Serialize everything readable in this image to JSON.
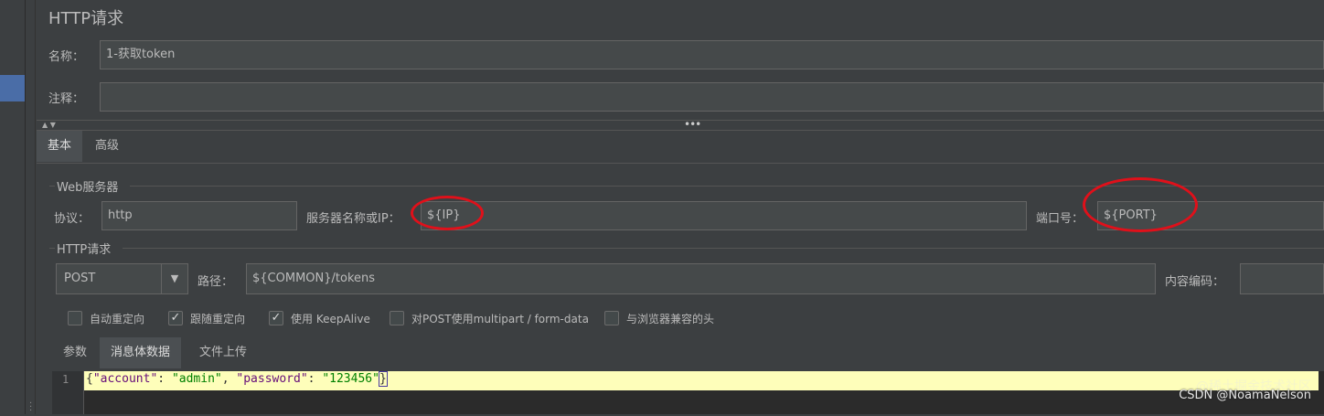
{
  "panel": {
    "title": "HTTP请求"
  },
  "name_row": {
    "label": "名称：",
    "value": "1-获取token"
  },
  "comment_row": {
    "label": "注释：",
    "value": ""
  },
  "tabs": {
    "basic": "基本",
    "advanced": "高级"
  },
  "web_server": {
    "section_title": "Web服务器",
    "protocol_label": "协议：",
    "protocol_value": "http",
    "server_label": "服务器名称或IP：",
    "server_value": "${IP}",
    "port_label": "端口号：",
    "port_value": "${PORT}"
  },
  "http_request": {
    "section_title": "HTTP请求",
    "method": "POST",
    "path_label": "路径：",
    "path_value": "${COMMON}/tokens",
    "encoding_label": "内容编码：",
    "encoding_value": ""
  },
  "options": [
    {
      "label": "自动重定向",
      "checked": false
    },
    {
      "label": "跟随重定向",
      "checked": true
    },
    {
      "label": "使用 KeepAlive",
      "checked": true
    },
    {
      "label": "对POST使用multipart / form-data",
      "checked": false
    },
    {
      "label": "与浏览器兼容的头",
      "checked": false
    }
  ],
  "body_tabs": {
    "params": "参数",
    "body": "消息体数据",
    "files": "文件上传"
  },
  "editor": {
    "line_number": "1",
    "open_brace": "{",
    "key1": "\"account\"",
    "colon1": ": ",
    "val1": "\"admin\"",
    "comma": ", ",
    "key2": "\"password\"",
    "colon2": ": ",
    "val2": "\"123456\"",
    "close_brace": "}"
  },
  "watermark": {
    "text": "CSDN @NoamaNelson",
    "faint_text": "@稀土掘金技术社区"
  },
  "colors": {
    "highlight": "#e0101a",
    "selection": "#4a6da7",
    "code_line_bg": "#fefeba"
  }
}
